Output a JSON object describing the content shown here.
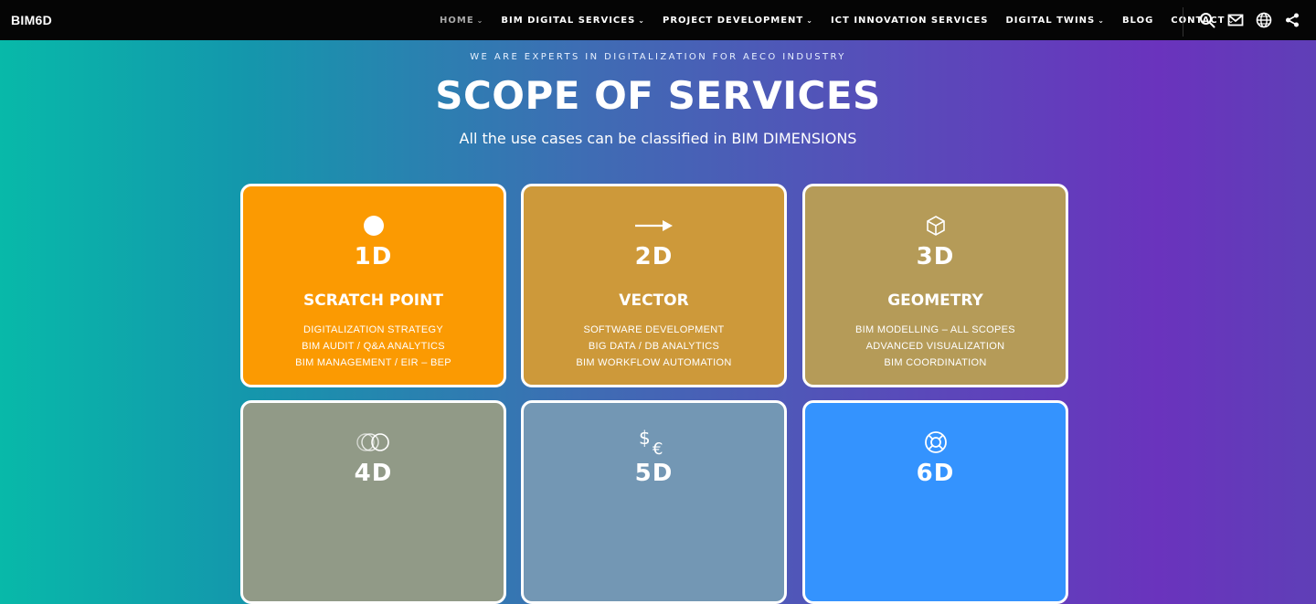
{
  "brand": {
    "logo": "BIM6D"
  },
  "nav": {
    "items": [
      {
        "label": "HOME",
        "dropdown": true,
        "active": true
      },
      {
        "label": "BIM DIGITAL SERVICES",
        "dropdown": true,
        "active": false
      },
      {
        "label": "PROJECT DEVELOPMENT",
        "dropdown": true,
        "active": false
      },
      {
        "label": "ICT INNOVATION SERVICES",
        "dropdown": false,
        "active": false
      },
      {
        "label": "DIGITAL TWINS",
        "dropdown": true,
        "active": false
      },
      {
        "label": "BLOG",
        "dropdown": false,
        "active": false
      },
      {
        "label": "CONTACT",
        "dropdown": true,
        "active": false
      }
    ],
    "icons": [
      "search-icon",
      "mail-icon",
      "globe-icon",
      "share-icon"
    ]
  },
  "hero": {
    "tagline": "WE ARE EXPERTS IN DIGITALIZATION FOR AECO INDUSTRY",
    "title": "SCOPE OF SERVICES",
    "subtitle": "All the use cases can be classified in BIM DIMENSIONS"
  },
  "cards": [
    {
      "dimension": "1D",
      "name": "SCRATCH POINT",
      "icon": "point-icon",
      "color": "#fb9a02",
      "lines": [
        "DIGITALIZATION STRATEGY",
        "BIM AUDIT / Q&A ANALYTICS",
        "BIM MANAGEMENT / EIR – BEP"
      ]
    },
    {
      "dimension": "2D",
      "name": "VECTOR",
      "icon": "arrow-right-icon",
      "color": "#cd993a",
      "lines": [
        "SOFTWARE DEVELOPMENT",
        "BIG DATA / DB ANALYTICS",
        "BIM WORKFLOW AUTOMATION"
      ]
    },
    {
      "dimension": "3D",
      "name": "GEOMETRY",
      "icon": "cube-icon",
      "color": "#b59b58",
      "lines": [
        "BIM MODELLING – ALL SCOPES",
        "ADVANCED VISUALIZATION",
        "BIM COORDINATION"
      ]
    },
    {
      "dimension": "4D",
      "name": "",
      "icon": "overlapping-circles-icon",
      "color": "#919a87",
      "lines": []
    },
    {
      "dimension": "5D",
      "name": "",
      "icon": "currency-icon",
      "color": "#7397b4",
      "lines": []
    },
    {
      "dimension": "6D",
      "name": "",
      "icon": "lifebuoy-icon",
      "color": "#3493fe",
      "lines": []
    }
  ]
}
